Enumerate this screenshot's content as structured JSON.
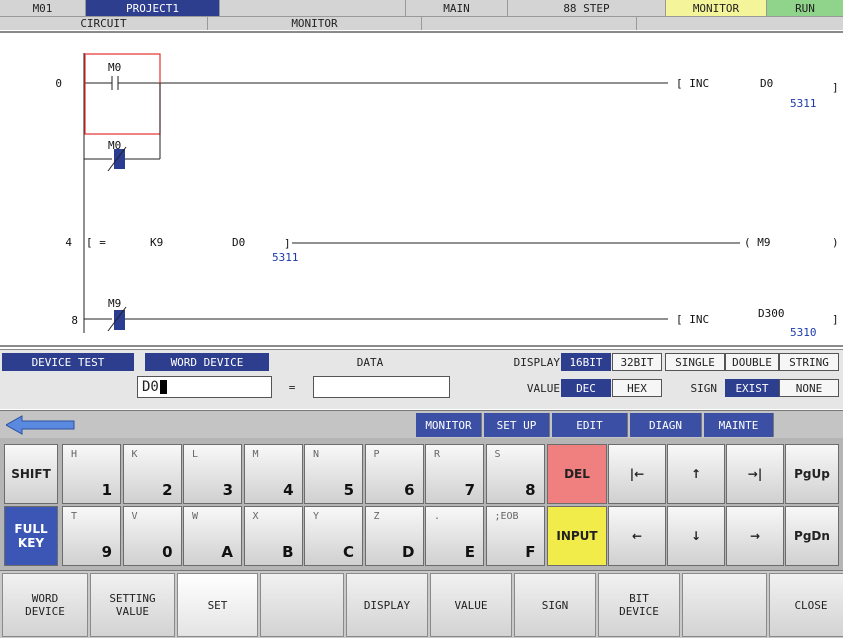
{
  "header": {
    "machine": "M01",
    "project": "PROJECT1",
    "program": "MAIN",
    "steps": "88 STEP",
    "mode": "MONITOR",
    "state": "RUN"
  },
  "subheader": {
    "circuit": "CIRCUIT",
    "monitor": "MONITOR"
  },
  "ladder": {
    "rungs": [
      {
        "step": "0",
        "contacts": [
          {
            "device": "M0",
            "type": "NO"
          },
          {
            "device": "M0",
            "type": "NC"
          }
        ],
        "instruction": "[ INC",
        "operand": "D0",
        "value": "5311"
      },
      {
        "step": "4",
        "compare_open": "[ =",
        "op1": "K9",
        "op2": "D0",
        "op2_value": "5311",
        "coil": "( M9",
        "coil_close": ")"
      },
      {
        "step": "8",
        "contacts": [
          {
            "device": "M9",
            "type": "NC"
          }
        ],
        "instruction": "[ INC",
        "operand": "D300",
        "value": "5310"
      }
    ]
  },
  "testbar": {
    "title": "DEVICE TEST",
    "word_device": "WORD DEVICE",
    "data_label": "DATA",
    "device_value": "D0",
    "equals": "=",
    "data_value": "",
    "display_label": "DISPLAY",
    "display_options": [
      "16BIT",
      "32BIT",
      "SINGLE",
      "DOUBLE",
      "STRING"
    ],
    "value_label": "VALUE",
    "value_options": [
      "DEC",
      "HEX"
    ],
    "sign_label": "SIGN",
    "sign_options": [
      "EXIST",
      "NONE"
    ]
  },
  "menu": {
    "items": [
      "MONITOR",
      "SET UP",
      "EDIT",
      "DIAGN",
      "MAINTE"
    ]
  },
  "keypad": {
    "shift": "SHIFT",
    "full_key": "FULL\nKEY",
    "row1": [
      {
        "s": "H",
        "m": "1"
      },
      {
        "s": "K",
        "m": "2"
      },
      {
        "s": "L",
        "m": "3"
      },
      {
        "s": "M",
        "m": "4"
      },
      {
        "s": "N",
        "m": "5"
      },
      {
        "s": "P",
        "m": "6"
      },
      {
        "s": "R",
        "m": "7"
      },
      {
        "s": "S",
        "m": "8"
      }
    ],
    "row2": [
      {
        "s": "T",
        "m": "9"
      },
      {
        "s": "V",
        "m": "0"
      },
      {
        "s": "W",
        "m": "A"
      },
      {
        "s": "X",
        "m": "B"
      },
      {
        "s": "Y",
        "m": "C"
      },
      {
        "s": "Z",
        "m": "D"
      },
      {
        "s": ".",
        "m": "E"
      },
      {
        "s": ";EOB",
        "m": "F"
      }
    ],
    "del": "DEL",
    "input": "INPUT",
    "home": "|←",
    "up": "↑",
    "end": "→|",
    "left": "←",
    "down": "↓",
    "right": "→",
    "pgup": "PgUp",
    "pgdn": "PgDn"
  },
  "fkeys": [
    "WORD\nDEVICE",
    "SETTING\nVALUE",
    "SET",
    "",
    "DISPLAY",
    "VALUE",
    "SIGN",
    "BIT\nDEVICE",
    "",
    "CLOSE"
  ],
  "colors": {
    "navy": "#2e3e8e",
    "monitor": "#f4f59a",
    "run": "#8fd48a",
    "del": "#f08080",
    "input": "#f2ec4a"
  }
}
